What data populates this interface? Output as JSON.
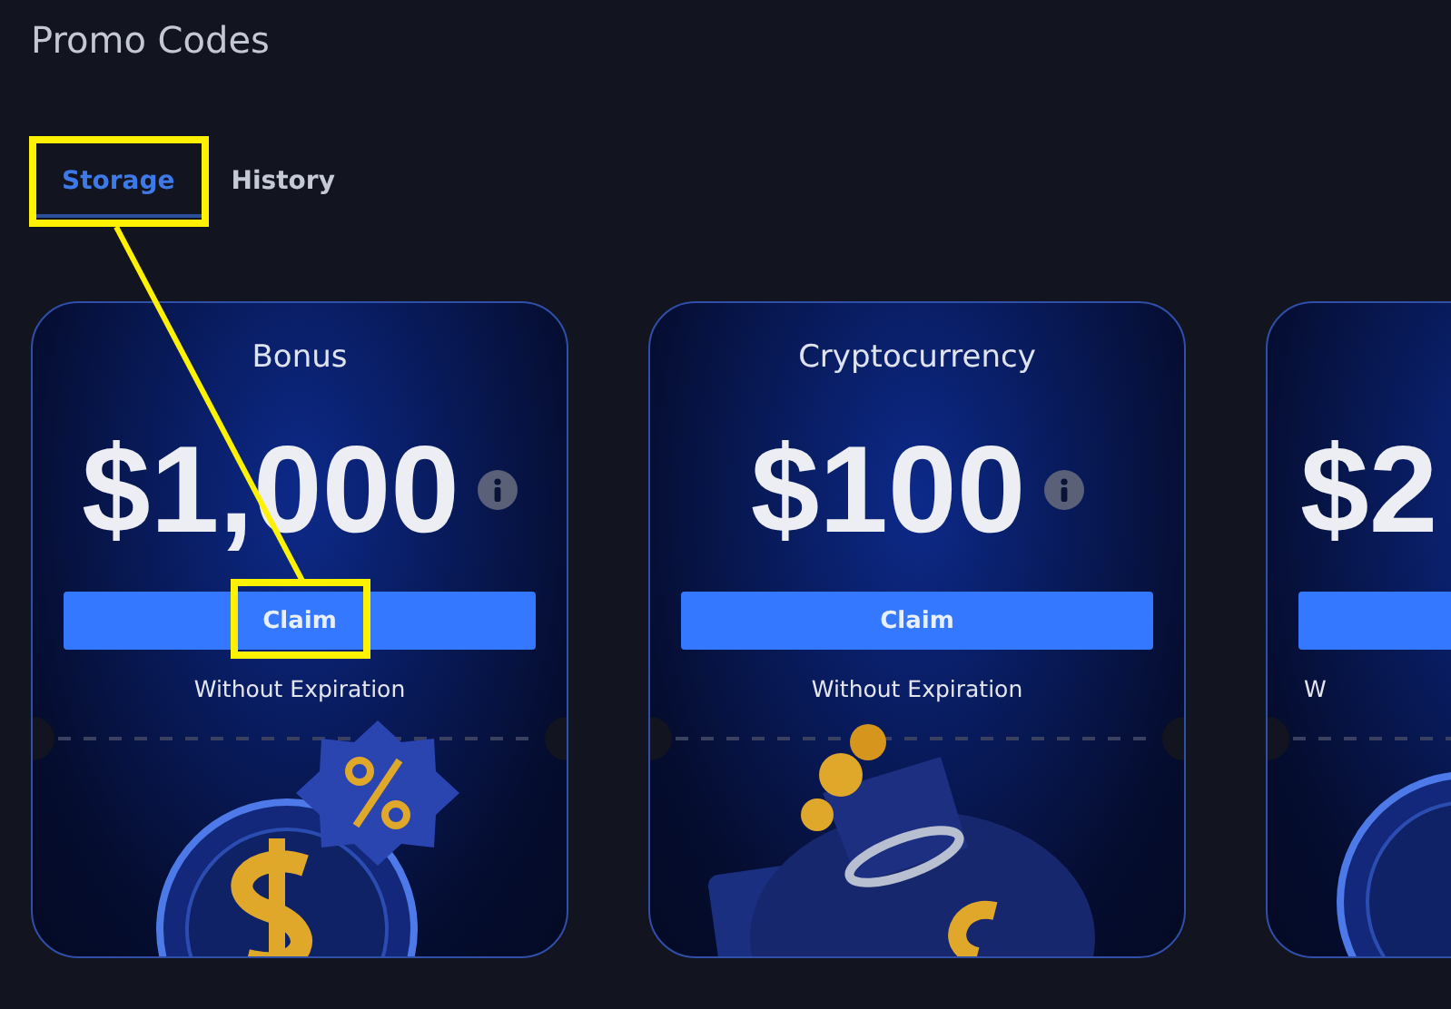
{
  "page": {
    "title": "Promo Codes"
  },
  "tabs": [
    {
      "label": "Storage",
      "selected": true
    },
    {
      "label": "History",
      "selected": false
    }
  ],
  "cards": [
    {
      "kind": "coin",
      "title": "Bonus",
      "amount": "$1,000",
      "button": "Claim",
      "expiry": "Without Expiration"
    },
    {
      "kind": "bag",
      "title": "Cryptocurrency",
      "amount": "$100",
      "button": "Claim",
      "expiry": "Without Expiration"
    },
    {
      "kind": "partial",
      "amount": "$2",
      "expiry": "W"
    }
  ]
}
